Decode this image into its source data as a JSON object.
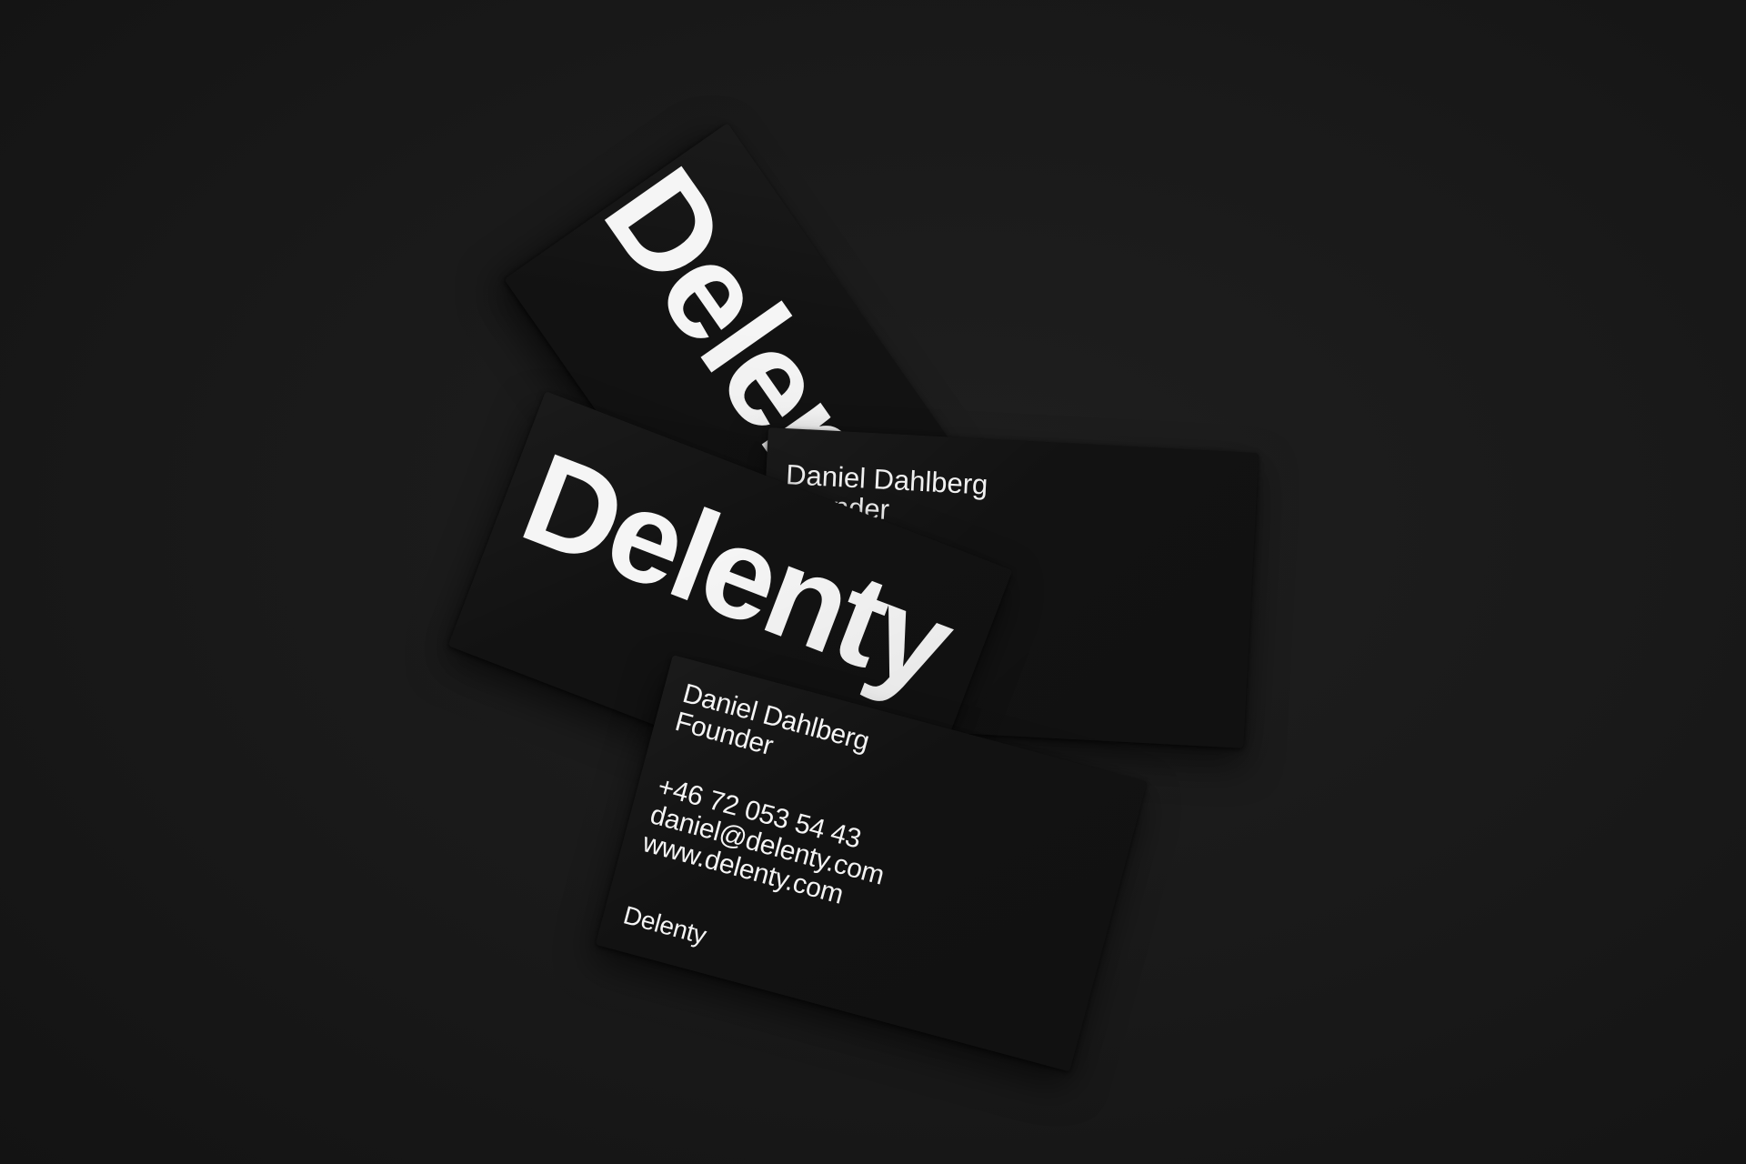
{
  "scene": {
    "background": "#191919",
    "card_color": "#121212",
    "text_color": "#f5f5f5"
  },
  "cards": {
    "logo_back": {
      "logo": "Delent"
    },
    "contact_back": {
      "name": "Daniel Dahlberg",
      "role": "Founder"
    },
    "logo_middle": {
      "logo": "Delenty"
    },
    "contact_front": {
      "name": "Daniel Dahlberg",
      "role": "Founder",
      "phone": "+46 72 053 54 43",
      "email": "daniel@delenty.com",
      "website": "www.delenty.com",
      "brand": "Delenty"
    }
  }
}
